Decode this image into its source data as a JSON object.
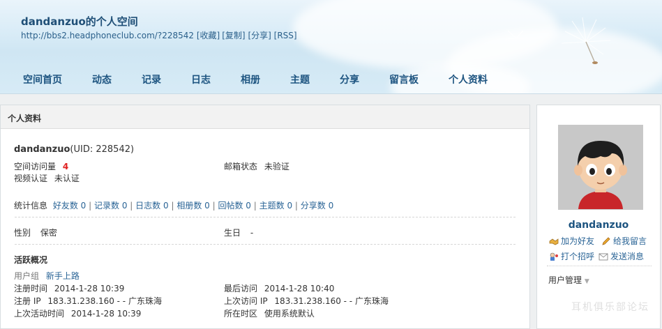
{
  "header": {
    "title": "dandanzuo的个人空间",
    "url": "http://bbs2.headphoneclub.com/?228542",
    "actions": [
      "[收藏]",
      "[复制]",
      "[分享]",
      "[RSS]"
    ]
  },
  "nav": [
    "空间首页",
    "动态",
    "记录",
    "日志",
    "相册",
    "主题",
    "分享",
    "留言板",
    "个人资料"
  ],
  "main": {
    "section_title": "个人资料",
    "username": "dandanzuo",
    "uid": "(UID: 228542)",
    "visits_label": "空间访问量",
    "visits_value": "4",
    "email_label": "邮箱状态",
    "email_value": "未验证",
    "video_label": "视频认证",
    "video_value": "未认证",
    "stats_label": "统计信息",
    "stats": [
      "好友数 0",
      "记录数 0",
      "日志数 0",
      "相册数 0",
      "回帖数 0",
      "主题数 0",
      "分享数 0"
    ],
    "gender_label": "性别",
    "gender_value": "保密",
    "birthday_label": "生日",
    "birthday_value": "-",
    "activity_title": "活跃概况",
    "group_label": "用户组",
    "group_value": "新手上路",
    "reg_time_label": "注册时间",
    "reg_time_value": "2014-1-28 10:39",
    "last_visit_label": "最后访问",
    "last_visit_value": "2014-1-28 10:40",
    "reg_ip_label": "注册 IP",
    "reg_ip_value": "183.31.238.160 - - 广东珠海",
    "last_ip_label": "上次访问 IP",
    "last_ip_value": "183.31.238.160 - - 广东珠海",
    "last_active_label": "上次活动时间",
    "last_active_value": "2014-1-28 10:39",
    "timezone_label": "所在时区",
    "timezone_value": "使用系统默认"
  },
  "side": {
    "username": "dandanzuo",
    "add_friend": "加为好友",
    "leave_message": "给我留言",
    "say_hi": "打个招呼",
    "send_message": "发送消息",
    "user_manage": "用户管理"
  },
  "watermark": "耳机俱乐部论坛",
  "colors": {
    "link": "#2a6496",
    "nav": "#1d5480",
    "accent_red": "#e02020"
  }
}
